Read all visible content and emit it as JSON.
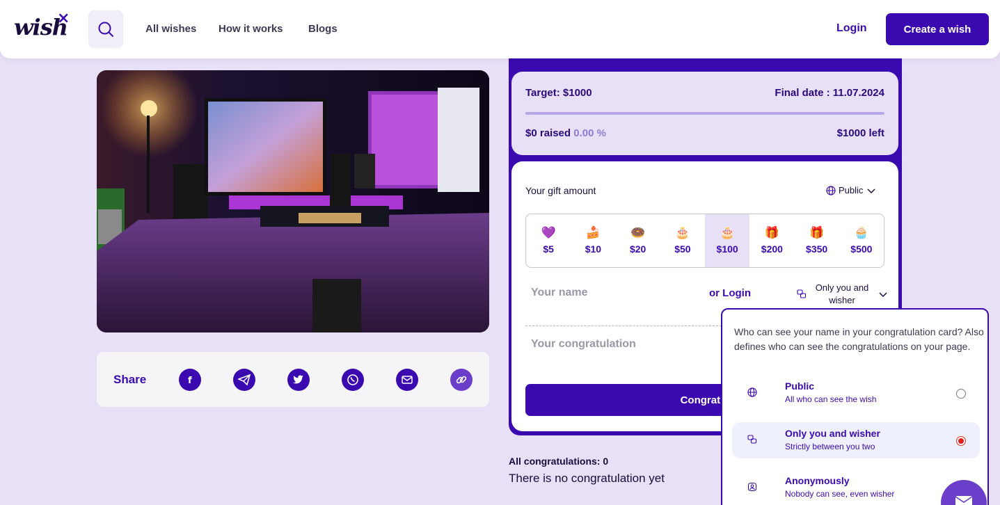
{
  "header": {
    "logo": "wish",
    "logo_mark": "×",
    "nav": [
      "All wishes",
      "How it works",
      "Blogs"
    ],
    "login": "Login",
    "create": "Create a wish"
  },
  "share": {
    "label": "Share",
    "icons": [
      "facebook-icon",
      "telegram-icon",
      "twitter-icon",
      "whatsapp-icon",
      "mail-icon",
      "link-icon"
    ]
  },
  "target": {
    "target": "Target: $1000",
    "final_date": "Final date : 11.07.2024",
    "raised": "$0 raised",
    "percent": "0.00 %",
    "left": "$1000 left",
    "progress": 0
  },
  "form": {
    "gift_label": "Your gift amount",
    "visibility": "Public",
    "amounts": [
      {
        "label": "$5",
        "icon": "💜"
      },
      {
        "label": "$10",
        "icon": "🍰"
      },
      {
        "label": "$20",
        "icon": "🍩"
      },
      {
        "label": "$50",
        "icon": "🎂"
      },
      {
        "label": "$100",
        "icon": "🎂"
      },
      {
        "label": "$200",
        "icon": "🎁"
      },
      {
        "label": "$350",
        "icon": "🎁"
      },
      {
        "label": "$500",
        "icon": "🧁"
      }
    ],
    "selected_amount": "$100",
    "name_placeholder": "Your name",
    "or_login": "or Login",
    "name_visibility": "Only you and wisher",
    "congrat_placeholder": "Your congratulation",
    "submit": "Congratul"
  },
  "congratulations": {
    "count": "All congratulations: 0",
    "empty": "There is no congratulation yet"
  },
  "popup": {
    "description": "Who can see your name in your congratulation card? Also defines who can see the congratulations on your page.",
    "options": [
      {
        "title": "Public",
        "subtitle": "All who can see the wish",
        "selected": false
      },
      {
        "title": "Only you and wisher",
        "subtitle": "Strictly between you two",
        "selected": true
      },
      {
        "title": "Anonymously",
        "subtitle": "Nobody can see, even wisher",
        "selected": false
      }
    ]
  },
  "colors": {
    "accent": "#3a0ab0",
    "background": "#e8e0f6"
  }
}
